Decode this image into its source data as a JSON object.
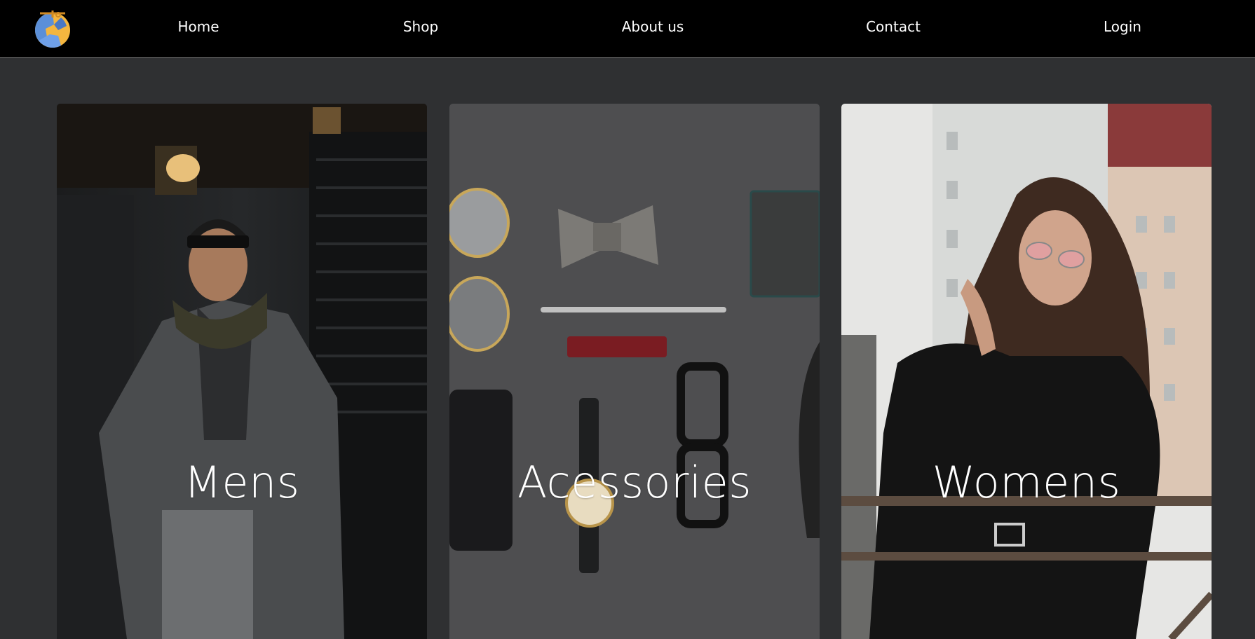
{
  "nav": {
    "logo_icon": "globe-logo-icon",
    "links": [
      "Home",
      "Shop",
      "About us",
      "Contact",
      "Login"
    ]
  },
  "categories": [
    {
      "title": "Mens",
      "photo": "man-in-grey-coat-photo"
    },
    {
      "title": "Acessories",
      "photo": "accessories-flatlay-photo"
    },
    {
      "title": "Womens",
      "photo": "woman-on-balcony-photo"
    }
  ],
  "colors": {
    "nav_bg": "#000000",
    "page_bg": "#2f3032",
    "text": "#ffffff"
  }
}
